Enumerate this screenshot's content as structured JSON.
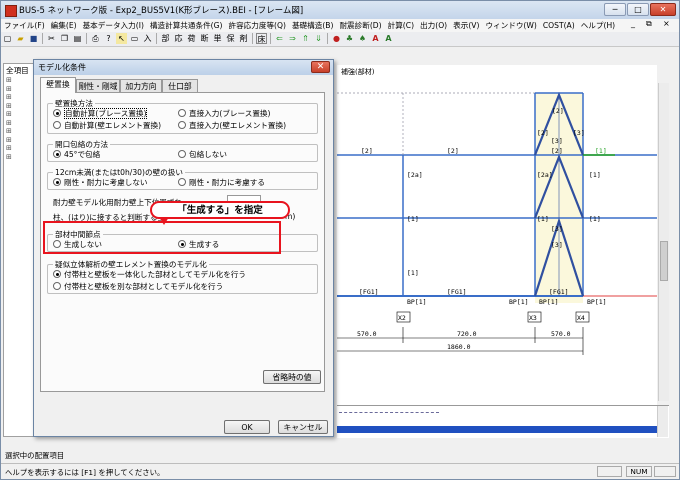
{
  "window": {
    "title": "BUS-5 ネットワーク版 - Exp2_BUS5V1(K形ブレース).BEI - [フレーム図]",
    "controls": {
      "minimize": "─",
      "maximize": "□",
      "close": "✕"
    }
  },
  "menubar": {
    "items": [
      "ファイル(F)",
      "編集(E)",
      "基本データ入力(I)",
      "構造計算共通条件(G)",
      "許容応力度等(Q)",
      "基礎構造(B)",
      "耐震診断(D)",
      "計算(C)",
      "出力(O)",
      "表示(V)",
      "ウィンドウ(W)",
      "COST(A)",
      "ヘルプ(H)"
    ],
    "right_controls": [
      "_",
      "⧉",
      "×"
    ]
  },
  "toolbar": {
    "text_buttons": [
      "入",
      "部",
      "応",
      "荷",
      "断",
      "単",
      "保",
      "剤",
      "床"
    ]
  },
  "tree": {
    "header": "全項目"
  },
  "canvas": {
    "header": "補強(部材)",
    "labels": {
      "top": "[2]",
      "left_beams": [
        "[2]",
        "[2]"
      ],
      "upper_brace": [
        "[2]",
        "[2]",
        "[3]",
        "[3]"
      ],
      "mid_labels": [
        "[2a]",
        "[2a]",
        "[1]"
      ],
      "green_label": "[1]",
      "lower_labels": [
        "[1]",
        "[1]",
        "[1]",
        "[3]",
        "[3]",
        "[1]"
      ],
      "fg": [
        "[FG1]",
        "[FG1]",
        "[FG1]"
      ],
      "bp": [
        "BP[1]",
        "BP[1]",
        "BP[1]",
        "BP[1]"
      ],
      "axes": [
        "X2",
        "X3",
        "X4"
      ],
      "dims": [
        "570.0",
        "720.0",
        "570.0"
      ],
      "total": "1860.0"
    }
  },
  "dialog": {
    "title": "モデル化条件",
    "close": "✕",
    "tabs": [
      "壁置換",
      "剛性・剛域",
      "加力方向",
      "仕口部"
    ],
    "group1": {
      "label": "壁置換方法",
      "options": [
        "自動計算(ブレース置換)",
        "直接入力(ブレース置換)",
        "自動計算(壁エレメント置換)",
        "直接入力(壁エレメント置換)"
      ],
      "selected": 0
    },
    "group2": {
      "label": "開口包絡の方法",
      "options": [
        "45°で包絡",
        "包絡しない"
      ],
      "selected": 0
    },
    "group3": {
      "label": "12cm未満(またはt0h/30)の壁の扱い",
      "options": [
        "剛性・耐力に考慮しない",
        "剛性・耐力に考慮する"
      ],
      "selected": 0
    },
    "line1": "耐力壁モデル化用耐力壁上下位置ずれ",
    "line2": "柱、(はり)に接すると判断する壁",
    "line2_suffix": "m)",
    "group4": {
      "label": "部材中間節点",
      "options": [
        "生成しない",
        "生成する"
      ],
      "selected": 1
    },
    "group5": {
      "label": "疑似立体解析の壁エレメント置換のモデル化",
      "options": [
        "付帯柱と壁板を一体化した部材としてモデル化を行う",
        "付帯柱と壁板を別な部材としてモデル化を行う"
      ],
      "selected": 0
    },
    "default_button": "省略時の値",
    "ok": "OK",
    "cancel": "キャンセル"
  },
  "callout": {
    "text": "「生成する」を指定"
  },
  "side_panel": {
    "label": "選択中の配置項目"
  },
  "status": {
    "help": "ヘルプを表示するには [F1] を押してください。",
    "num": "NUM"
  },
  "colors": {
    "highlight": "#e8141e",
    "brace": "#3050a0",
    "member": "#3a6ec8",
    "panel_fill": "#fbf8dc",
    "selection": "#2050c0"
  }
}
